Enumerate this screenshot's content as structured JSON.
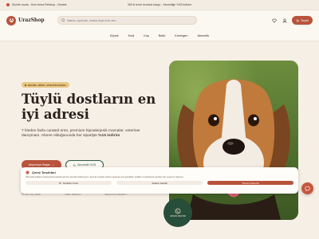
{
  "topbar": {
    "left_text": "Sizinle moda - Hızlı tema Petshop - Destek",
    "center_text": "350 ₺ üzeri ücretsiz kargo · Aboneliğe %15 indirim"
  },
  "header": {
    "logo": "UrazShop",
    "search_placeholder": "Mama, oyuncak, marka veya ürün ara...",
    "cart_label": "Sepet"
  },
  "nav": {
    "items": [
      "Köpek",
      "Kedi",
      "Kuş",
      "Balık",
      "Kemirgen",
      "Abonelik"
    ]
  },
  "hero": {
    "badge": "290.000+ ÜRÜN · AYNI GÜN KARGO",
    "title_line1": "Tüylü dostların en",
    "title_line2": "iyi adresi",
    "desc_main": "7 binden fazla curated ürün, premium hipoalerjenik mamalar, veteriner danışmanı. Abone olduğunuzda her siparişte",
    "desc_bold": "%15 indirim",
    "primary_btn": "Alışverişe Başla",
    "secondary_btn": "Abonelik %15",
    "features": [
      "ÜCRETSİZ İADE",
      "HIZLI KARGO",
      "MÜŞTERİ HİZMETİ"
    ]
  },
  "cookie": {
    "title": "Çerez Tercihleri",
    "text": "Sitemizde kullanıcı deneyiminizi iyileştirmek için çerezler kullanıyoruz. Zorunlu çerezler sitenin çalışması için gereklidir; analitik ve pazarlama çerezleri için onayınızı istiyoruz.",
    "btn_prefs": "Tercihleri Yönet",
    "btn_required": "Sadece Gerekli",
    "btn_accept": "Tümünü Kabul Et"
  },
  "floating": {
    "wa_label": "UZMAN DESTEK"
  },
  "colors": {
    "brand": "#b9533b",
    "green": "#274e3b",
    "badge": "#e8c784",
    "background": "#f6efe6"
  }
}
